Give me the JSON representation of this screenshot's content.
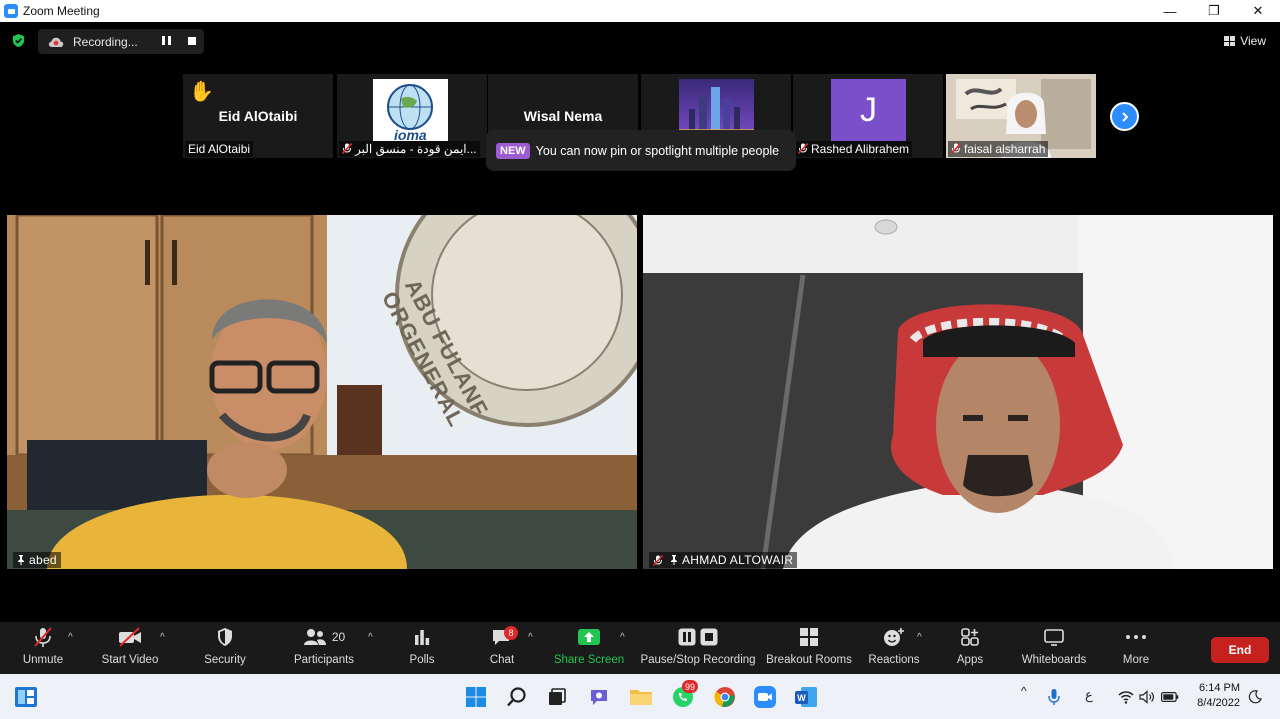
{
  "window": {
    "title": "Zoom Meeting",
    "minimize": "—",
    "restore": "❐",
    "close": "✕"
  },
  "topbar": {
    "recording_label": "Recording...",
    "view_label": "View"
  },
  "thumbnails": [
    {
      "name_center": "Eid AlOtaibi",
      "label": "Eid AlOtaibi",
      "raised_hand": "✋",
      "muted": false
    },
    {
      "name_center": "",
      "label": "ايمن قودة - منسق البر...",
      "logo_text": "ioma",
      "muted": true
    },
    {
      "name_center": "Wisal Nema",
      "label": "",
      "muted": false
    },
    {
      "name_center": "",
      "label": "",
      "muted": false
    },
    {
      "name_center": "J",
      "label": "Rashed Alibrahem",
      "muted": true
    },
    {
      "name_center": "",
      "label": "faisal alsharrah",
      "muted": true
    }
  ],
  "tooltip": {
    "badge": "NEW",
    "text": "You can now pin or spotlight multiple people"
  },
  "tiles": [
    {
      "label": "abed",
      "pinned": true,
      "muted": false,
      "seal_text": "ABU FULANF ORGENERAL"
    },
    {
      "label": "AHMAD ALTOWAIR",
      "pinned": true,
      "muted": true
    }
  ],
  "toolbar": {
    "unmute": "Unmute",
    "start_video": "Start Video",
    "security": "Security",
    "participants": "Participants",
    "participants_count": "20",
    "polls": "Polls",
    "chat": "Chat",
    "chat_badge": "8",
    "share_screen": "Share Screen",
    "pause_recording": "Pause/Stop Recording",
    "breakout_rooms": "Breakout Rooms",
    "reactions": "Reactions",
    "apps": "Apps",
    "whiteboards": "Whiteboards",
    "more": "More",
    "end": "End"
  },
  "taskbar": {
    "whatsapp_badge": "99",
    "ime_char": "ع",
    "time": "6:14 PM",
    "date": "8/4/2022"
  },
  "colors": {
    "zoom_blue": "#2d8cff",
    "end_red": "#c5211e",
    "share_green": "#23c552",
    "new_badge": "#9d5bd2"
  }
}
